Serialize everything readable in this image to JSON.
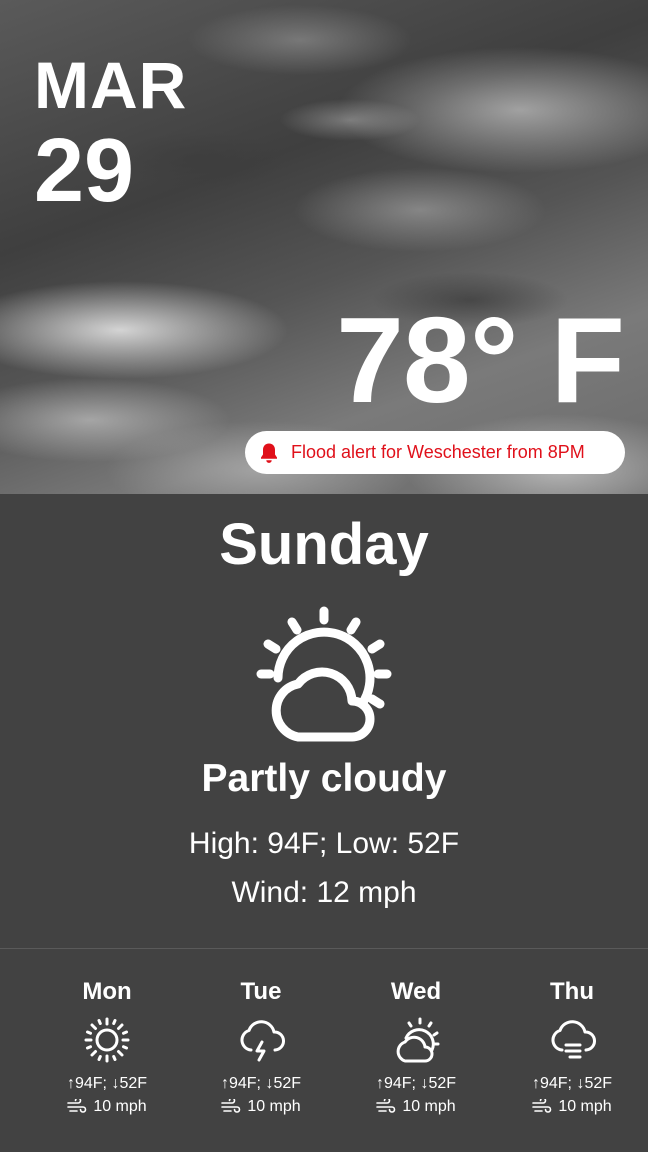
{
  "header": {
    "month": "MAR",
    "day": "29",
    "temperature": "78° F",
    "alert": {
      "icon": "bell-icon",
      "text": "Flood alert for Weschester from 8PM",
      "color": "#e0101a"
    }
  },
  "today": {
    "day_name": "Sunday",
    "icon": "partly-cloudy-icon",
    "condition": "Partly cloudy",
    "high_low": "High: 94F; Low: 52F",
    "wind": "Wind: 12 mph"
  },
  "forecast": [
    {
      "day": "Mon",
      "icon": "sunny-icon",
      "hilo": "↑94F; ↓52F",
      "wind_icon": "wind-icon",
      "wind": "10 mph"
    },
    {
      "day": "Tue",
      "icon": "thunderstorm-icon",
      "hilo": "↑94F; ↓52F",
      "wind_icon": "wind-icon",
      "wind": "10 mph"
    },
    {
      "day": "Wed",
      "icon": "partly-cloudy-icon",
      "hilo": "↑94F; ↓52F",
      "wind_icon": "wind-icon",
      "wind": "10 mph"
    },
    {
      "day": "Thu",
      "icon": "fog-icon",
      "hilo": "↑94F; ↓52F",
      "wind_icon": "wind-icon",
      "wind": "10 mph"
    }
  ]
}
